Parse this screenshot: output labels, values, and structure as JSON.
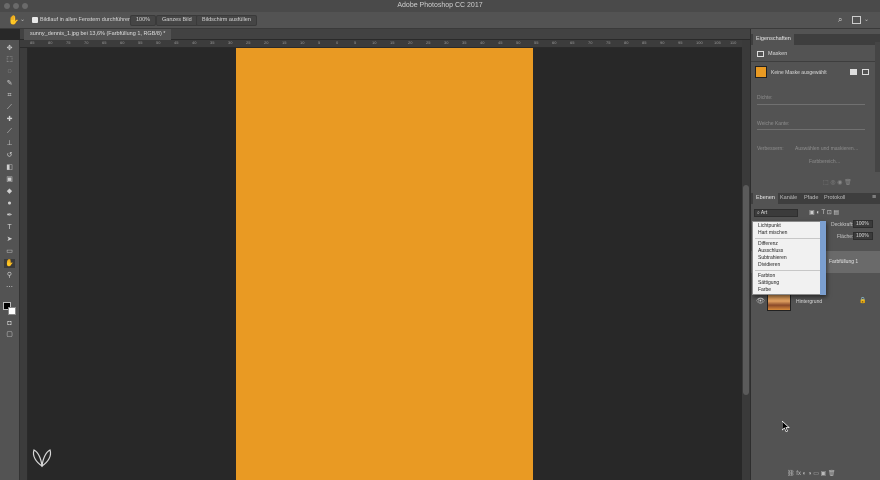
{
  "window": {
    "title": "Adobe Photoshop CC 2017"
  },
  "options_bar": {
    "scroll_all_label": "Bildlauf in allen Fenstern durchführen",
    "zoom_100_label": "100%",
    "fit_screen_label": "Ganzes Bild",
    "fill_screen_label": "Bildschirm ausfüllen"
  },
  "document": {
    "tab_label": "sunny_dennis_1.jpg bei 13,6% (Farbfüllung 1, RGB/8) *",
    "fill_color": "#e99a23"
  },
  "ruler": {
    "ticks": [
      "85",
      "80",
      "75",
      "70",
      "65",
      "60",
      "55",
      "50",
      "45",
      "40",
      "35",
      "30",
      "25",
      "20",
      "15",
      "10",
      "5",
      "0",
      "5",
      "10",
      "15",
      "20",
      "25",
      "30",
      "35",
      "40",
      "45",
      "50",
      "55",
      "60",
      "65",
      "70",
      "75",
      "80",
      "85",
      "90",
      "95",
      "100",
      "105",
      "110"
    ]
  },
  "properties_panel": {
    "title": "Eigenschaften",
    "section_label": "Masken",
    "mask_status": "Keine Maske ausgewählt",
    "density_label": "Dichte:",
    "feather_label": "Weiche Kante:",
    "refine_label": "Verbessern:",
    "select_mask_button": "Auswählen und maskieren…",
    "color_range_button": "Farbbereich…"
  },
  "layers_panel": {
    "tabs": [
      "Ebenen",
      "Kanäle",
      "Pfade",
      "Protokoll"
    ],
    "kind_label": "Art",
    "opacity_label": "Deckkraft:",
    "opacity_value": "100%",
    "fill_label": "Fläche:",
    "fill_value": "100%",
    "layers": [
      {
        "name": "Farbfüllung 1"
      },
      {
        "name": "Hintergrund"
      }
    ]
  },
  "blend_menu": {
    "items": [
      "Lichtpunkt",
      "Hart mischen",
      "Differenz",
      "Ausschluss",
      "Subtrahieren",
      "Dividieren",
      "Farbton",
      "Sättigung",
      "Farbe"
    ]
  }
}
